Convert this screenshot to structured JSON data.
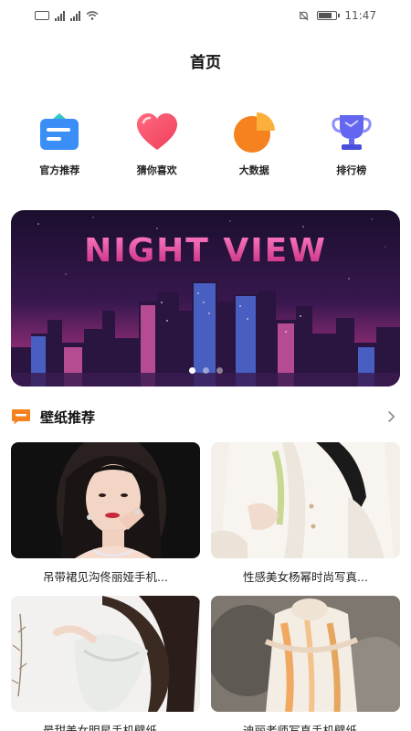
{
  "status_bar": {
    "time": "11:47",
    "sim_label": "B"
  },
  "header": {
    "title": "首页"
  },
  "quick_nav": [
    {
      "label": "官方推荐",
      "icon": "recommend-card-icon",
      "color": "#3a8ef6"
    },
    {
      "label": "猜你喜欢",
      "icon": "heart-icon",
      "color": "#f0506e"
    },
    {
      "label": "大数据",
      "icon": "pie-chart-icon",
      "color": "#f5821f"
    },
    {
      "label": "排行榜",
      "icon": "trophy-icon",
      "color": "#5b5ef0"
    }
  ],
  "banner": {
    "title": "NIGHT VIEW",
    "slide_count": 3,
    "active_slide": 1
  },
  "section": {
    "title": "壁纸推荐",
    "icon": "chat-bubble-icon",
    "accent": "#f5821f"
  },
  "wallpapers": [
    {
      "caption": "吊带裙见沟佟丽娅手机..."
    },
    {
      "caption": "性感美女杨幂时尚写真..."
    },
    {
      "caption": "最甜美女明星手机壁纸..."
    },
    {
      "caption": "迪丽老师写真手机壁纸..."
    }
  ]
}
